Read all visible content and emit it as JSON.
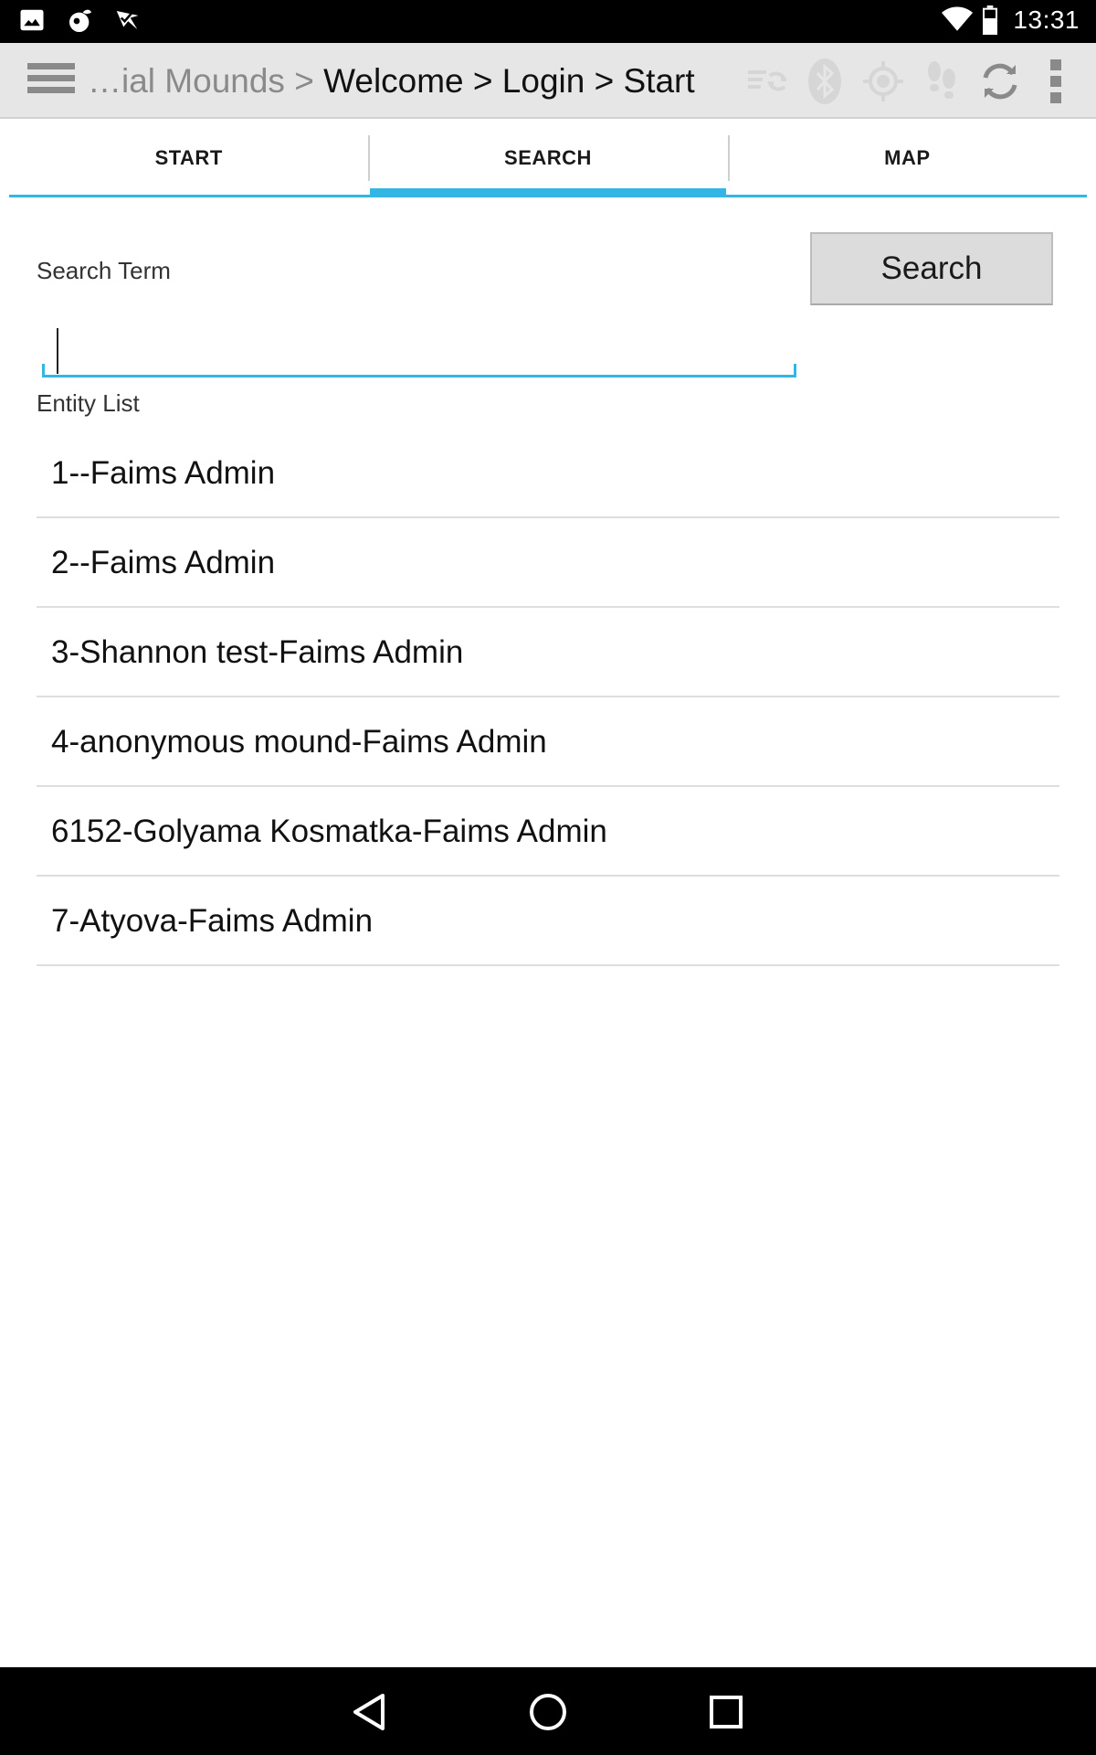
{
  "status_bar": {
    "time": "13:31",
    "left_icons": [
      "image-icon",
      "notification-app-icon",
      "download-done-icon"
    ],
    "right_icons": [
      "wifi-icon",
      "battery-icon"
    ]
  },
  "action_bar": {
    "breadcrumb_muted": "…ial Mounds > ",
    "breadcrumb_path": "Welcome > Login > Start",
    "icons": [
      "sync-status-icon",
      "bluetooth-icon",
      "gps-icon",
      "tracking-icon",
      "refresh-icon",
      "overflow-menu-icon"
    ],
    "colors": {
      "background": "#e6e6e6",
      "disabled_icon": "#d0d0d0",
      "active_icon": "#8a8a8a"
    }
  },
  "tabs": [
    {
      "label": "START",
      "active": false
    },
    {
      "label": "SEARCH",
      "active": true
    },
    {
      "label": "MAP",
      "active": false
    }
  ],
  "search": {
    "label": "Search Term",
    "button_label": "Search",
    "value": "",
    "placeholder": ""
  },
  "entity_list": {
    "label": "Entity List",
    "items": [
      "1--Faims Admin",
      "2--Faims Admin",
      "3-Shannon test-Faims Admin",
      "4-anonymous mound-Faims Admin",
      "6152-Golyama Kosmatka-Faims Admin",
      "7-Atyova-Faims Admin"
    ]
  },
  "nav_bar": {
    "buttons": [
      "back-icon",
      "home-icon",
      "recents-icon"
    ]
  },
  "colors": {
    "accent": "#33b5e5",
    "status_bar": "#000000"
  }
}
